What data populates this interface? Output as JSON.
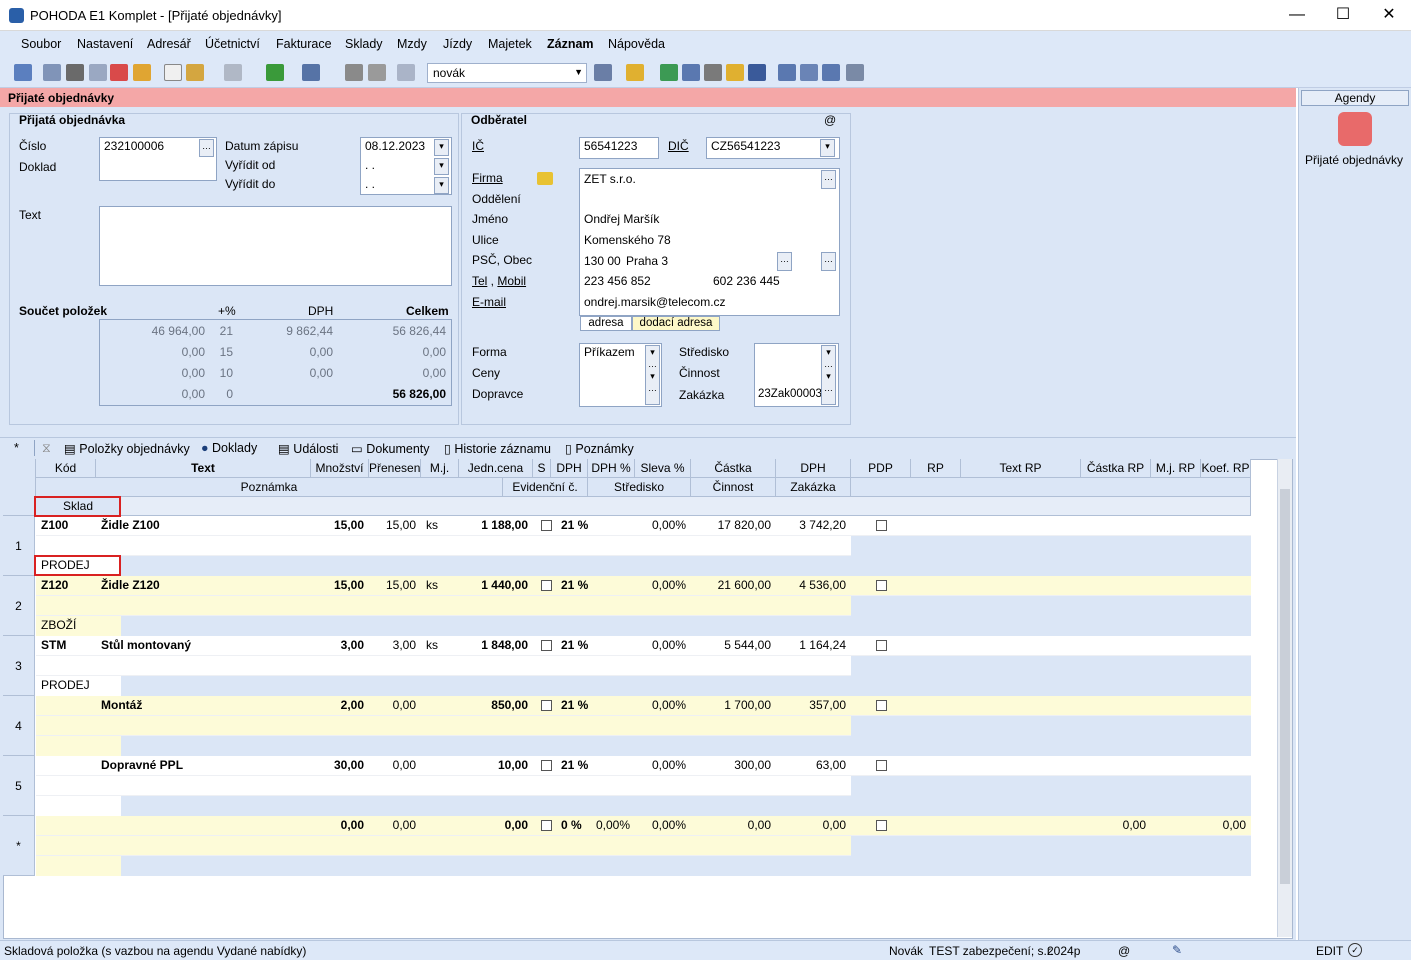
{
  "window": {
    "title": "POHODA E1 Komplet - [Přijaté objednávky]",
    "minimize": "—",
    "maximize": "☐",
    "close": "✕"
  },
  "menu": [
    "Soubor",
    "Nastavení",
    "Adresář",
    "Účetnictví",
    "Fakturace",
    "Sklady",
    "Mzdy",
    "Jízdy",
    "Majetek",
    "Záznam",
    "Nápověda"
  ],
  "toolbar": {
    "user": "novák"
  },
  "agenda_header": "Přijaté objednávky",
  "order": {
    "section": "Přijatá objednávka",
    "cislo_label": "Číslo",
    "cislo": "232100006",
    "doklad_label": "Doklad",
    "datum_zapisu_label": "Datum zápisu",
    "datum_zapisu": "08.12.2023",
    "vyridit_od_label": "Vyřídit od",
    "vyridit_od": " .  .",
    "vyridit_do_label": "Vyřídit do",
    "vyridit_do": " .  .",
    "text_label": "Text"
  },
  "sums": {
    "title": "Součet položek",
    "col_pct": "+%",
    "col_dph": "DPH",
    "col_total": "Celkem",
    "rows": [
      [
        "46 964,00",
        "21",
        "9 862,44",
        "56 826,44"
      ],
      [
        "0,00",
        "15",
        "0,00",
        "0,00"
      ],
      [
        "0,00",
        "10",
        "0,00",
        "0,00"
      ],
      [
        "0,00",
        "0",
        "",
        "56 826,00"
      ]
    ]
  },
  "customer": {
    "section": "Odběratel",
    "at": "@",
    "ic_label": "IČ",
    "ic": "56541223",
    "dic_label": "DIČ",
    "dic": "CZ56541223",
    "firma_label": "Firma",
    "firma": "ZET s.r.o.",
    "oddeleni_label": "Oddělení",
    "jmeno_label": "Jméno",
    "jmeno": "Ondřej Maršík",
    "ulice_label": "Ulice",
    "ulice": "Komenského 78",
    "psc_label": "PSČ, Obec",
    "psc": "130 00",
    "obec": "Praha 3",
    "tel_label": "Tel",
    "mobil_label": "Mobil",
    "tel": "223 456 852",
    "mobil": "602 236 445",
    "email_label": "E-mail",
    "email": "ondrej.marsik@telecom.cz",
    "tab_adresa": "adresa",
    "tab_dodaci": "dodací adresa",
    "forma_label": "Forma",
    "forma": "Příkazem",
    "ceny_label": "Ceny",
    "dopravce_label": "Dopravce",
    "stredisko_label": "Středisko",
    "cinnost_label": "Činnost",
    "zakazka_label": "Zakázka",
    "zakazka": "23Zak00003"
  },
  "tabs": [
    "*",
    "Položky objednávky",
    "Doklady",
    "Události",
    "Dokumenty",
    "Historie záznamu",
    "Poznámky"
  ],
  "grid": {
    "headers1": [
      "Kód",
      "Text",
      "Množství",
      "Přenesen",
      "M.j.",
      "Jedn.cena",
      "S",
      "DPH",
      "DPH %",
      "Sleva %",
      "Částka",
      "DPH",
      "PDP",
      "RP",
      "Text RP",
      "Částka RP",
      "M.j. RP",
      "Koef. RP"
    ],
    "headers2": [
      "Poznámka",
      "Evidenční č.",
      "Středisko",
      "Činnost",
      "Zakázka"
    ],
    "header3": "Sklad",
    "rows": [
      {
        "n": "1",
        "kod": "Z100",
        "text": "Židle Z100",
        "mn": "15,00",
        "pren": "15,00",
        "mj": "ks",
        "cena": "1 188,00",
        "dph": "21 %",
        "sleva": "0,00%",
        "castka": "17 820,00",
        "dphc": "3 742,20",
        "sklad": "PRODEJ"
      },
      {
        "n": "2",
        "kod": "Z120",
        "text": "Židle Z120",
        "mn": "15,00",
        "pren": "15,00",
        "mj": "ks",
        "cena": "1 440,00",
        "dph": "21 %",
        "sleva": "0,00%",
        "castka": "21 600,00",
        "dphc": "4 536,00",
        "sklad": "ZBOŽÍ"
      },
      {
        "n": "3",
        "kod": "STM",
        "text": "Stůl montovaný",
        "mn": "3,00",
        "pren": "3,00",
        "mj": "ks",
        "cena": "1 848,00",
        "dph": "21 %",
        "sleva": "0,00%",
        "castka": "5 544,00",
        "dphc": "1 164,24",
        "sklad": "PRODEJ"
      },
      {
        "n": "4",
        "kod": "",
        "text": "Montáž",
        "mn": "2,00",
        "pren": "0,00",
        "mj": "",
        "cena": "850,00",
        "dph": "21 %",
        "sleva": "0,00%",
        "castka": "1 700,00",
        "dphc": "357,00",
        "sklad": ""
      },
      {
        "n": "5",
        "kod": "",
        "text": "Dopravné PPL",
        "mn": "30,00",
        "pren": "0,00",
        "mj": "",
        "cena": "10,00",
        "dph": "21 %",
        "sleva": "0,00%",
        "castka": "300,00",
        "dphc": "63,00",
        "sklad": ""
      },
      {
        "n": "*",
        "kod": "",
        "text": "",
        "mn": "0,00",
        "pren": "0,00",
        "mj": "",
        "cena": "0,00",
        "dph": "0 %",
        "dphpct": "0,00%",
        "sleva": "0,00%",
        "castka": "0,00",
        "dphc": "0,00",
        "castkarp": "0,00",
        "koef": "0,00",
        "sklad": ""
      }
    ]
  },
  "agendy": {
    "title": "Agendy",
    "item": "Přijaté objednávky"
  },
  "status": {
    "left": "Skladová položka (s vazbou na agendu Vydané nabídky)",
    "user": "Novák",
    "company": "TEST zabezpečení; s.r.",
    "year": "2024p",
    "at": "@",
    "mode": "EDIT"
  }
}
